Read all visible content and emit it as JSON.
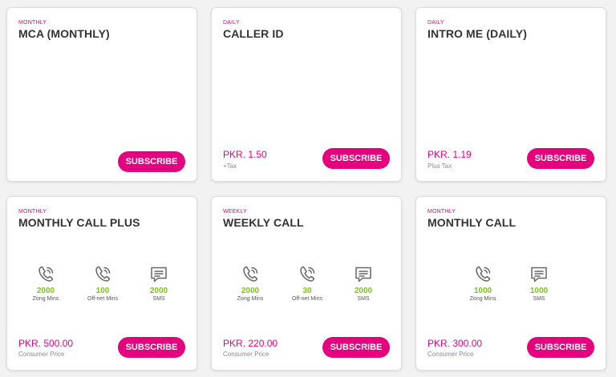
{
  "colors": {
    "accent": "#e5007e",
    "green": "#7cc416"
  },
  "cards": [
    {
      "tag": "MONTHLY",
      "title": "MCA (MONTHLY)",
      "button": "SUBSCRIBE"
    },
    {
      "tag": "DAILY",
      "title": "CALLER ID",
      "price": "PKR. 1.50",
      "note": "+Tax",
      "button": "SUBSCRIBE"
    },
    {
      "tag": "DAILY",
      "title": "INTRO ME (DAILY)",
      "price": "PKR. 1.19",
      "note": "Plus Tax",
      "button": "SUBSCRIBE"
    },
    {
      "tag": "MONTHLY",
      "title": "MONTHLY CALL PLUS",
      "features": [
        {
          "icon": "phone-icon",
          "value": "2000",
          "label": "Zong Mins"
        },
        {
          "icon": "phone-icon",
          "value": "100",
          "label": "Off-net Mins"
        },
        {
          "icon": "message-icon",
          "value": "2000",
          "label": "SMS"
        }
      ],
      "price": "PKR. 500.00",
      "note": "Consumer Price",
      "button": "SUBSCRIBE"
    },
    {
      "tag": "WEEKLY",
      "title": "WEEKLY CALL",
      "features": [
        {
          "icon": "phone-icon",
          "value": "2000",
          "label": "Zong Mins"
        },
        {
          "icon": "phone-icon",
          "value": "30",
          "label": "Off-net Mins"
        },
        {
          "icon": "message-icon",
          "value": "2000",
          "label": "SMS"
        }
      ],
      "price": "PKR. 220.00",
      "note": "Consumer Price",
      "button": "SUBSCRIBE"
    },
    {
      "tag": "MONTHLY",
      "title": "MONTHLY CALL",
      "features": [
        {
          "icon": "phone-icon",
          "value": "1000",
          "label": "Zong Mins"
        },
        {
          "icon": "message-icon",
          "value": "1000",
          "label": "SMS"
        }
      ],
      "price": "PKR. 300.00",
      "note": "Consumer Price",
      "button": "SUBSCRIBE"
    }
  ]
}
